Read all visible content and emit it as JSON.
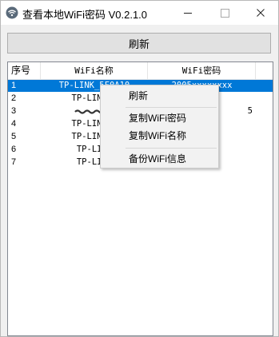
{
  "window": {
    "title": "查看本地WiFi密码 V0.2.1.0"
  },
  "toolbar": {
    "refresh_label": "刷新"
  },
  "list": {
    "columns": [
      "序号",
      "WiFi名称",
      "WiFi密码"
    ],
    "rows": [
      {
        "index": "1",
        "name": "TP-LINK_5F0A10",
        "password": "2005xxxxxxxx",
        "selected": true
      },
      {
        "index": "2",
        "name": "TP-LINK_5",
        "password": "",
        "selected": false
      },
      {
        "index": "3",
        "name": "",
        "password": "5",
        "selected": false
      },
      {
        "index": "4",
        "name": "TP-LINK_5",
        "password": "",
        "selected": false
      },
      {
        "index": "5",
        "name": "TP-LINK_5",
        "password": "",
        "selected": false
      },
      {
        "index": "6",
        "name": "TP-LINK",
        "password": "",
        "selected": false
      },
      {
        "index": "7",
        "name": "TP-LINK",
        "password": "",
        "selected": false
      }
    ]
  },
  "context_menu": {
    "items": [
      "刷新",
      "复制WiFi密码",
      "复制WiFi名称",
      "备份WiFi信息"
    ]
  },
  "colors": {
    "selection": "#0078d7",
    "window_bg": "#f0f0f0",
    "button_bg": "#e1e1e1"
  },
  "icons": {
    "app": "wifi-icon",
    "minimize": "minimize-icon",
    "maximize": "maximize-icon",
    "close": "close-icon"
  }
}
